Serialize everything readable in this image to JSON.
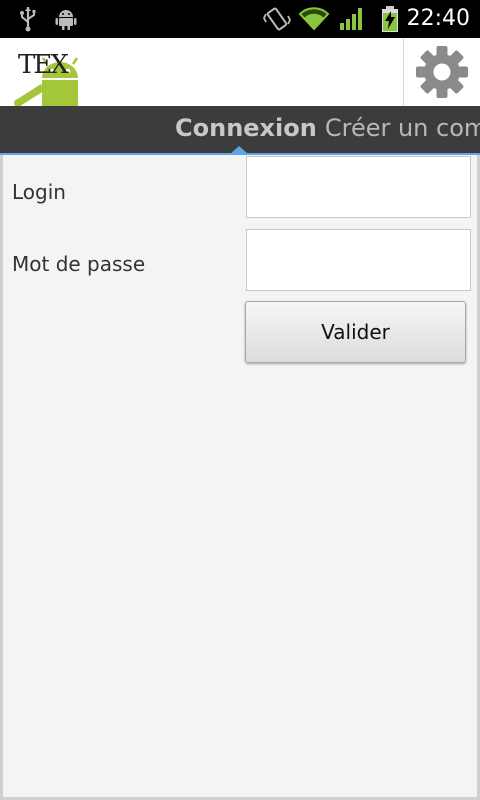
{
  "status_bar": {
    "time": "22:40",
    "icons": [
      "usb-icon",
      "android-debug-icon",
      "vibrate-icon",
      "wifi-icon",
      "signal-icon",
      "battery-charging-icon"
    ]
  },
  "action_bar": {
    "logo_text": "TEX",
    "settings_icon": "gear-icon"
  },
  "tabs": [
    {
      "label": "Connexion",
      "active": true
    },
    {
      "label": "Créer un com",
      "active": false
    }
  ],
  "form": {
    "login_label": "Login",
    "login_value": "",
    "password_label": "Mot de passe",
    "password_value": "",
    "submit_label": "Valider"
  },
  "colors": {
    "accent": "#5fa4e6",
    "android_green": "#a4c639",
    "tab_bg": "#3c3c3c"
  }
}
